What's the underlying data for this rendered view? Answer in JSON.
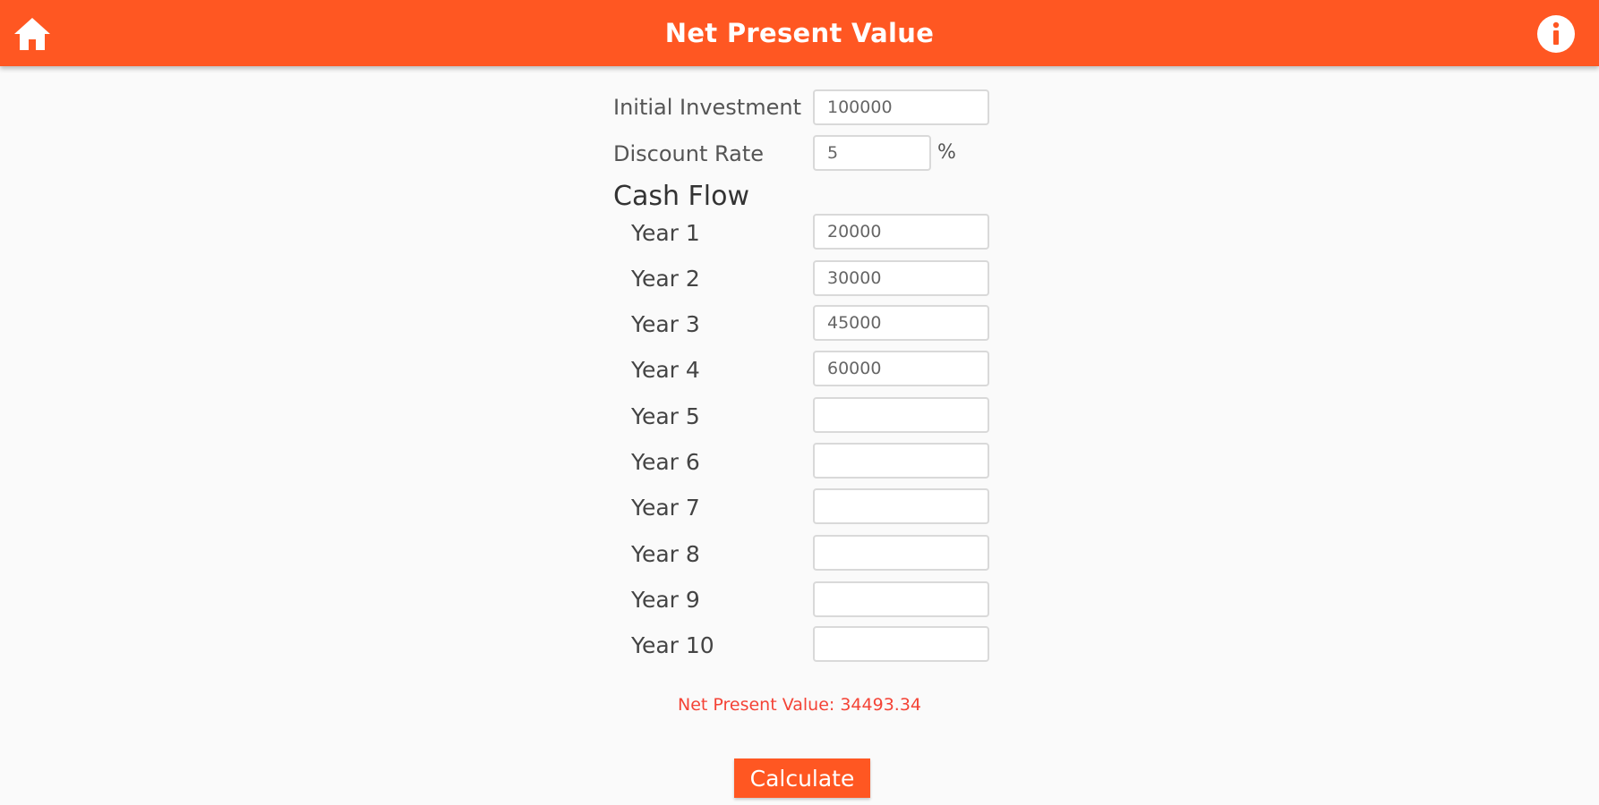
{
  "header": {
    "title": "Net Present Value",
    "home_icon": "home-icon",
    "info_icon": "info-icon",
    "background": "#ff5722"
  },
  "inputs": {
    "initial_investment": {
      "label": "Initial Investment",
      "value": "100000"
    },
    "discount_rate": {
      "label": "Discount Rate",
      "value": "5",
      "unit": "%"
    }
  },
  "cash_flow": {
    "title": "Cash Flow",
    "years": [
      {
        "label": "Year 1",
        "value": "20000"
      },
      {
        "label": "Year 2",
        "value": "30000"
      },
      {
        "label": "Year 3",
        "value": "45000"
      },
      {
        "label": "Year 4",
        "value": "60000"
      },
      {
        "label": "Year 5",
        "value": ""
      },
      {
        "label": "Year 6",
        "value": ""
      },
      {
        "label": "Year 7",
        "value": ""
      },
      {
        "label": "Year 8",
        "value": ""
      },
      {
        "label": "Year 9",
        "value": ""
      },
      {
        "label": "Year 10",
        "value": ""
      }
    ]
  },
  "result": {
    "text": "Net Present Value: 34493.34",
    "color": "#f44336"
  },
  "actions": {
    "calculate_label": "Calculate",
    "accent": "#ff5722"
  }
}
